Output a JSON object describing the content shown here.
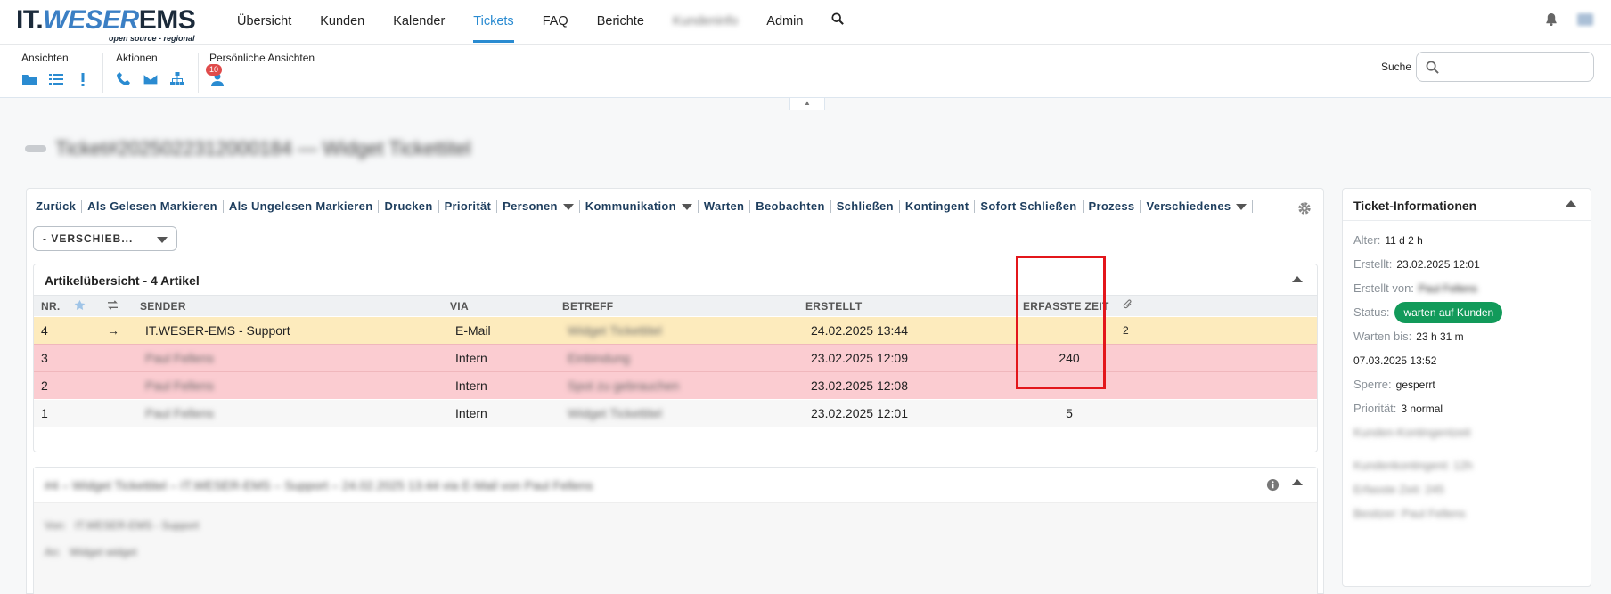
{
  "brand": {
    "logo_it": "IT.",
    "logo_weser": "WESER",
    "logo_ems": "EMS",
    "tagline": "open source - regional"
  },
  "nav": {
    "items": [
      "Übersicht",
      "Kunden",
      "Kalender",
      "Tickets",
      "FAQ",
      "Berichte",
      "Kundeninfo",
      "Admin"
    ],
    "active": "Tickets"
  },
  "toolbar": {
    "views_label": "Ansichten",
    "actions_label": "Aktionen",
    "personal_label": "Persönliche Ansichten",
    "personal_badge": "10",
    "search_label": "Suche",
    "search_value": ""
  },
  "ticket": {
    "title": "Ticket#2025022312000184 — Widget Tickettitel"
  },
  "actions": [
    {
      "label": "Zurück",
      "dropdown": false
    },
    {
      "label": "Als Gelesen Markieren",
      "dropdown": false
    },
    {
      "label": "Als Ungelesen Markieren",
      "dropdown": false
    },
    {
      "label": "Drucken",
      "dropdown": false
    },
    {
      "label": "Priorität",
      "dropdown": false
    },
    {
      "label": "Personen",
      "dropdown": true
    },
    {
      "label": "Kommunikation",
      "dropdown": true
    },
    {
      "label": "Warten",
      "dropdown": false
    },
    {
      "label": "Beobachten",
      "dropdown": false
    },
    {
      "label": "Schließen",
      "dropdown": false
    },
    {
      "label": "Kontingent",
      "dropdown": false
    },
    {
      "label": "Sofort Schließen",
      "dropdown": false
    },
    {
      "label": "Prozess",
      "dropdown": false
    },
    {
      "label": "Verschiedenes",
      "dropdown": true
    }
  ],
  "move_select": {
    "value": "- VERSCHIEB..."
  },
  "articles": {
    "title": "Artikelübersicht - 4 Artikel",
    "columns": [
      "NR.",
      "",
      "",
      "SENDER",
      "VIA",
      "BETREFF",
      "ERSTELLT",
      "ERFASSTE ZEIT",
      ""
    ],
    "rows": [
      {
        "nr": "4",
        "direction": "→",
        "sender": "IT.WESER-EMS - Support",
        "via": "E-Mail",
        "subject": "Widget Tickettitel",
        "created": "24.02.2025 13:44",
        "time": "",
        "attachments": "2",
        "style": "yellow"
      },
      {
        "nr": "3",
        "direction": "",
        "sender": "Paul Fellens",
        "via": "Intern",
        "subject": "Einbindung",
        "created": "23.02.2025 12:09",
        "time": "240",
        "attachments": "",
        "style": "red"
      },
      {
        "nr": "2",
        "direction": "",
        "sender": "Paul Fellens",
        "via": "Intern",
        "subject": "Spot zu gebrauchen",
        "created": "23.02.2025 12:08",
        "time": "",
        "attachments": "",
        "style": "red"
      },
      {
        "nr": "1",
        "direction": "",
        "sender": "Paul Fellens",
        "via": "Intern",
        "subject": "Widget Tickettitel",
        "created": "23.02.2025 12:01",
        "time": "5",
        "attachments": "",
        "style": "grey"
      }
    ]
  },
  "article_detail": {
    "header": "#4 – Widget Tickettitel – IT.WESER-EMS – Support – 24.02.2025 13:44 via E-Mail von Paul Fellens",
    "from_label": "Von:",
    "from_value": "IT.WESER-EMS - Support",
    "to_label": "An:",
    "to_value": "Widget widget"
  },
  "ticket_info": {
    "title": "Ticket-Informationen",
    "age_label": "Alter:",
    "age_value": "11 d 2 h",
    "created_label": "Erstellt:",
    "created_value": "23.02.2025 12:01",
    "created_by_label": "Erstellt von:",
    "created_by_value": "Paul Fellens",
    "status_label": "Status:",
    "status_value": "warten auf Kunden",
    "pending_label": "Warten bis:",
    "pending_value": "23 h 31 m",
    "pending_date": "07.03.2025 13:52",
    "lock_label": "Sperre:",
    "lock_value": "gesperrt",
    "priority_label": "Priorität:",
    "priority_value": "3 normal",
    "extra_1": "Kunden-Kontingentzeit",
    "extra_2": "Kundenkontingent: 12h",
    "extra_3": "Erfasste Zeit: 245",
    "extra_4": "Besitzer: Paul Fellens"
  },
  "colors": {
    "accent": "#2a8bd1",
    "status_green": "#129a5a",
    "row_yellow": "#fdebbd",
    "row_red": "#fbccd1",
    "highlight": "#e3161b"
  }
}
